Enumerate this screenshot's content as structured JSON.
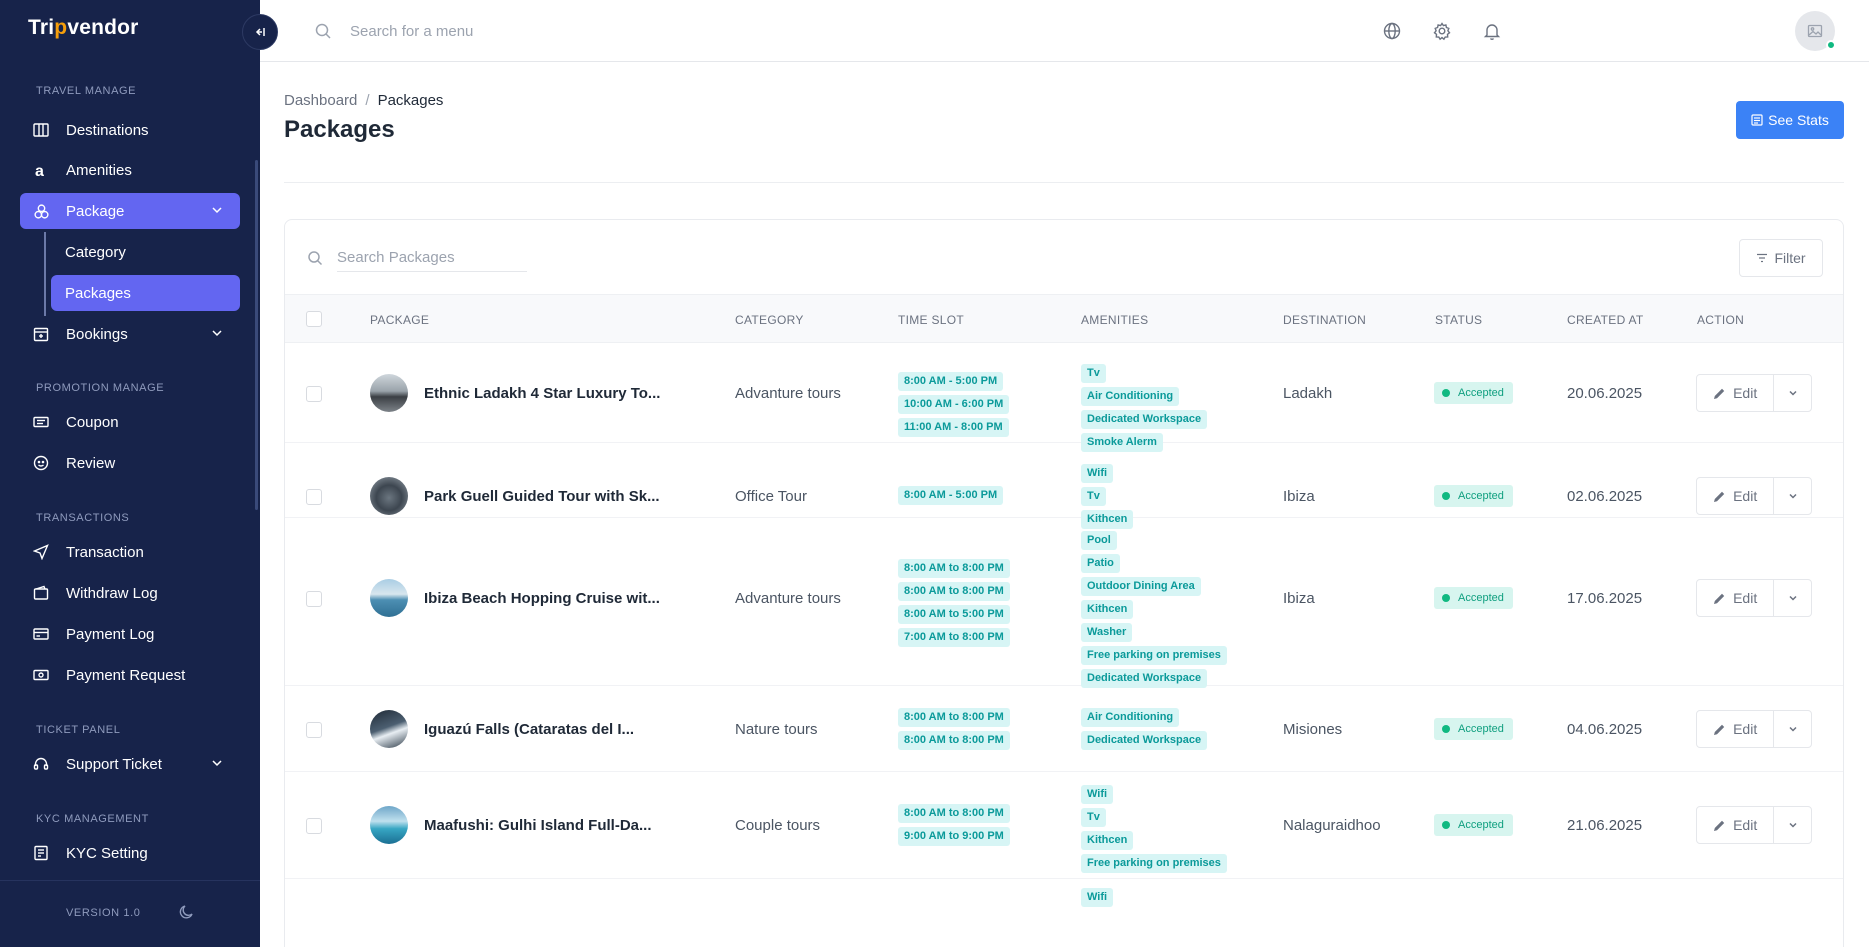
{
  "brand": {
    "name_pre": "Tri",
    "name_accent": "p",
    "name_post": "vendor"
  },
  "sidebar": {
    "sections": [
      {
        "title": "TRAVEL MANAGE"
      },
      {
        "title": "PROMOTION MANAGE"
      },
      {
        "title": "TRANSACTIONS"
      },
      {
        "title": "TICKET PANEL"
      },
      {
        "title": "KYC MANAGEMENT"
      }
    ],
    "items": {
      "destinations": "Destinations",
      "amenities": "Amenities",
      "package": "Package",
      "category": "Category",
      "packages": "Packages",
      "bookings": "Bookings",
      "coupon": "Coupon",
      "review": "Review",
      "transaction": "Transaction",
      "withdraw_log": "Withdraw Log",
      "payment_log": "Payment Log",
      "payment_request": "Payment Request",
      "support_ticket": "Support Ticket",
      "kyc_setting": "KYC Setting"
    },
    "version": "VERSION 1.0"
  },
  "topbar": {
    "search_placeholder": "Search for a menu"
  },
  "page": {
    "breadcrumb": {
      "home": "Dashboard",
      "sep": "/",
      "current": "Packages"
    },
    "title": "Packages",
    "stats_button": "See Stats"
  },
  "table": {
    "search_placeholder": "Search Packages",
    "filter_label": "Filter",
    "headers": {
      "package": "PACKAGE",
      "category": "CATEGORY",
      "time_slot": "TIME SLOT",
      "amenities": "AMENITIES",
      "destination": "DESTINATION",
      "status": "STATUS",
      "created_at": "CREATED AT",
      "action": "ACTION"
    },
    "edit_label": "Edit",
    "rows": [
      {
        "name": "Ethnic Ladakh 4 Star Luxury To...",
        "category": "Advanture tours",
        "time_slots": [
          "8:00 AM - 5:00 PM",
          "10:00 AM - 6:00 PM",
          "11:00 AM - 8:00 PM"
        ],
        "amenities": [
          "Tv",
          "Air Conditioning",
          "Dedicated Workspace",
          "Smoke Alerm"
        ],
        "destination": "Ladakh",
        "status": "Accepted",
        "created_at": "20.06.2025"
      },
      {
        "name": "Park Guell Guided Tour with Sk...",
        "category": "Office Tour",
        "time_slots": [
          "8:00 AM - 5:00 PM"
        ],
        "amenities": [
          "Wifi",
          "Tv",
          "Kithcen"
        ],
        "destination": "Ibiza",
        "status": "Accepted",
        "created_at": "02.06.2025"
      },
      {
        "name": "Ibiza Beach Hopping Cruise wit...",
        "category": "Advanture tours",
        "time_slots": [
          "8:00 AM to 8:00 PM",
          "8:00 AM to 8:00 PM",
          "8:00 AM to 5:00 PM",
          "7:00 AM to 8:00 PM"
        ],
        "amenities": [
          "Pool",
          "Patio",
          "Outdoor Dining Area",
          "Kithcen",
          "Washer",
          "Free parking on premises",
          "Dedicated Workspace"
        ],
        "destination": "Ibiza",
        "status": "Accepted",
        "created_at": "17.06.2025"
      },
      {
        "name": "Iguazú Falls (Cataratas del I...",
        "category": "Nature tours",
        "time_slots": [
          "8:00 AM to 8:00 PM",
          "8:00 AM to 8:00 PM"
        ],
        "amenities": [
          "Air Conditioning",
          "Dedicated Workspace"
        ],
        "destination": "Misiones",
        "status": "Accepted",
        "created_at": "04.06.2025"
      },
      {
        "name": "Maafushi: Gulhi Island Full-Da...",
        "category": "Couple tours",
        "time_slots": [
          "8:00 AM to 8:00 PM",
          "9:00 AM to 9:00 PM"
        ],
        "amenities": [
          "Wifi",
          "Tv",
          "Kithcen",
          "Free parking on premises"
        ],
        "destination": "Nalaguraidhoo",
        "status": "Accepted",
        "created_at": "21.06.2025"
      }
    ],
    "partial_row": {
      "amenities": [
        "Wifi"
      ]
    }
  },
  "colors": {
    "sidebar_bg": "#17234a",
    "active_nav": "#6366f1",
    "primary_button": "#3b82f6",
    "chip_bg": "#d7f5f5",
    "chip_text": "#0b9a9a",
    "status_bg": "#d7f5ef",
    "status_dot": "#10b981"
  },
  "icons": {
    "destinations": "map-icon",
    "amenities": "amenities-icon",
    "package": "package-icon",
    "bookings": "calendar-icon",
    "coupon": "ticket-icon",
    "review": "smile-icon",
    "transaction": "send-icon",
    "withdraw_log": "wallet-icon",
    "payment_log": "card-icon",
    "payment_request": "money-icon",
    "support_ticket": "headset-icon",
    "kyc_setting": "id-card-icon"
  }
}
